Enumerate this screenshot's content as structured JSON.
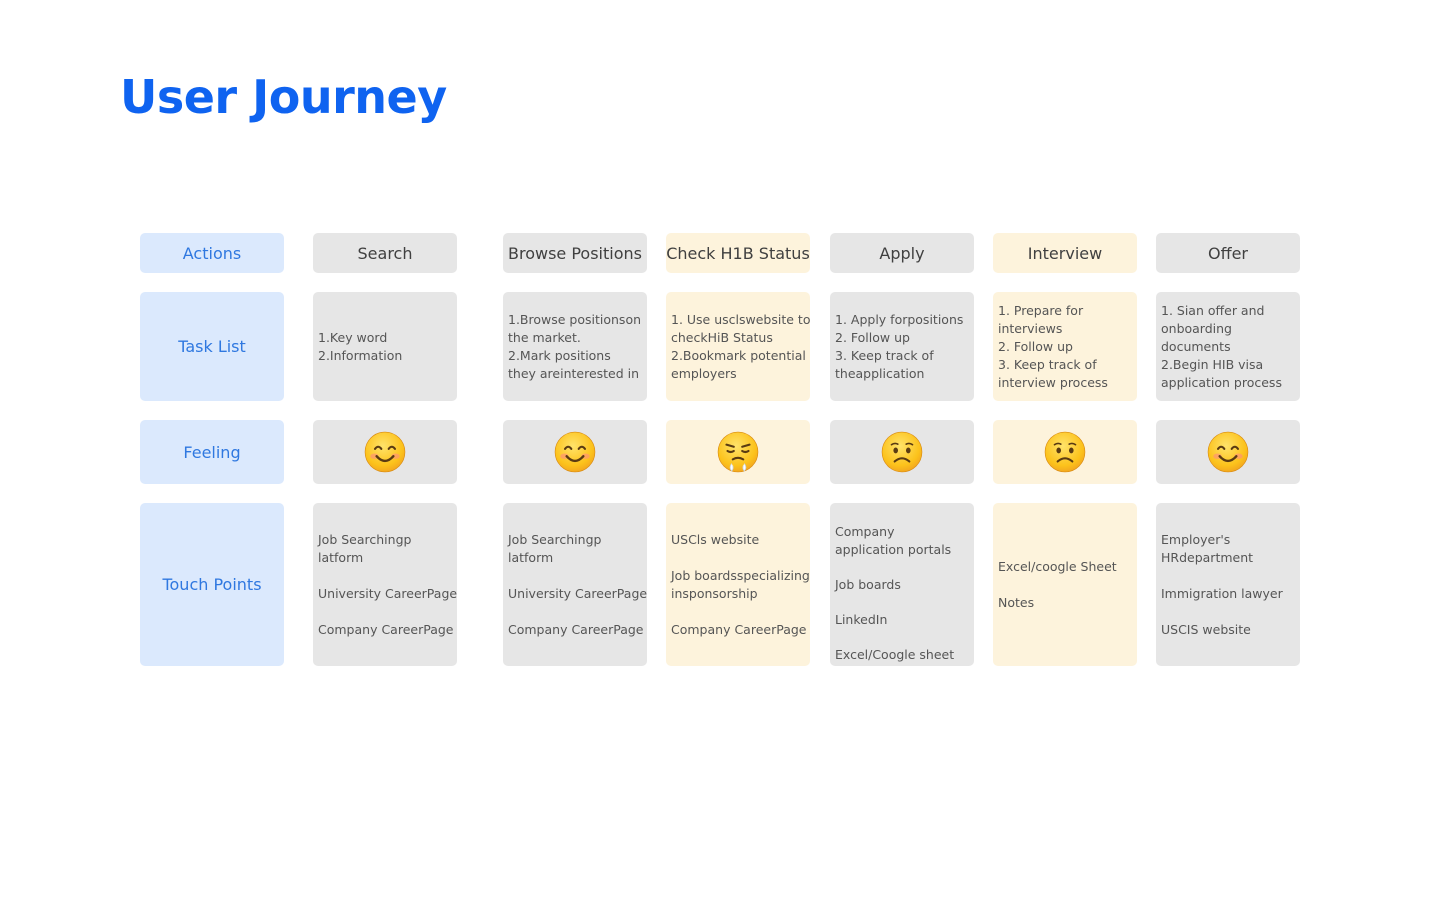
{
  "title": "User Journey",
  "colors": {
    "title": "#0f63f0",
    "label_bg": "#dbe9fd",
    "label_text": "#2f78e0",
    "gray_bg": "#e6e6e6",
    "yellow_bg": "#fdf3dc"
  },
  "row_labels": {
    "actions": "Actions",
    "tasks": "Task List",
    "feeling": "Feeling",
    "touch": "Touch Points"
  },
  "stages": [
    {
      "action": "Search",
      "highlight": false,
      "tasks": [
        "1.Key word",
        "2.Information"
      ],
      "feeling": "smiling-face-icon",
      "touchpoints": [
        "Job Searchingp",
        "latform",
        "",
        "University CareerPage",
        "",
        "Company CareerPage"
      ]
    },
    {
      "action": "Browse Positions",
      "highlight": false,
      "tasks": [
        "1.Browse positionson",
        "the market.",
        "2.Mark positions",
        "they areinterested in"
      ],
      "feeling": "smiling-face-icon",
      "touchpoints": [
        "Job Searchingp",
        "latform",
        "",
        "University CareerPage",
        "",
        "Company CareerPage"
      ]
    },
    {
      "action": "Check H1B Status",
      "highlight": true,
      "tasks": [
        "1. Use usclswebsite to",
        "checkHiB Status",
        "2.Bookmark potential",
        "employers"
      ],
      "feeling": "steaming-face-icon",
      "touchpoints": [
        "USCls website",
        "",
        "Job boardsspecializing",
        "insponsorship",
        "",
        "Company CareerPage"
      ]
    },
    {
      "action": "Apply",
      "highlight": false,
      "tasks": [
        "1. Apply forpositions",
        "2. Follow up",
        "3. Keep track of",
        "theapplication"
      ],
      "feeling": "worried-face-icon",
      "touchpoints": [
        "Company",
        "application portals",
        "",
        "Job boards",
        "",
        "LinkedIn",
        "",
        "Excel/Coogle sheet"
      ]
    },
    {
      "action": "Interview",
      "highlight": true,
      "tasks": [
        "1. Prepare for",
        "interviews",
        "2. Follow up",
        "3. Keep track of",
        "interview process"
      ],
      "feeling": "worried-face-icon",
      "touchpoints": [
        "Excel/coogle Sheet",
        "",
        "Notes"
      ]
    },
    {
      "action": "Offer",
      "highlight": false,
      "tasks": [
        "1. Sian offer and",
        "onboarding",
        "documents",
        "2.Begin HIB visa",
        "application process"
      ],
      "feeling": "smiling-face-icon",
      "touchpoints": [
        "Employer's",
        "HRdepartment",
        "",
        "Immigration lawyer",
        "",
        "USCIS website"
      ]
    }
  ]
}
